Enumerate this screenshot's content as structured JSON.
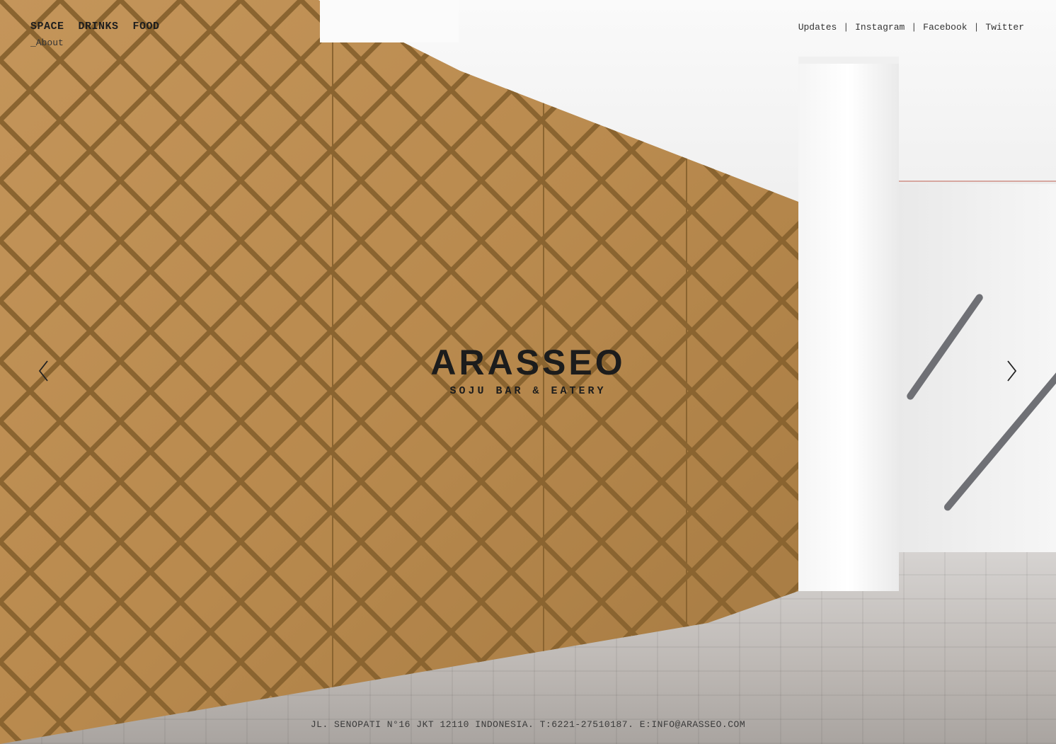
{
  "nav": {
    "items": [
      "SPACE",
      "DRINKS",
      "FOOD"
    ],
    "sub_item": "_About"
  },
  "social": {
    "links": [
      "Updates",
      "Instagram",
      "Facebook",
      "Twitter"
    ],
    "separator": "|"
  },
  "brand": {
    "name": "ARASSEO",
    "tagline": "SOJU BAR & EATERY"
  },
  "footer": {
    "address": "JL. SENOPATI N°16 JKT 12110 INDONESIA. T:6221-27510187. E:INFO@ARASSEO.COM"
  },
  "colors": {
    "wood": "#b8884a",
    "wood_dark": "#8a6430",
    "text": "#1e1e1e"
  },
  "icons": {
    "prev": "chevron-left-icon",
    "next": "chevron-right-icon"
  }
}
